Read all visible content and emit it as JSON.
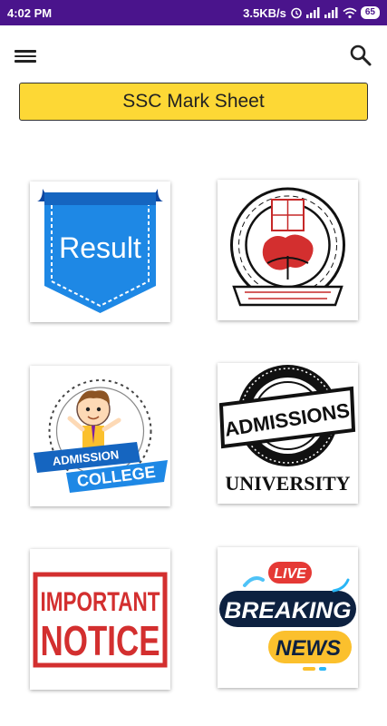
{
  "status_bar": {
    "time": "4:02 PM",
    "network_speed": "3.5KB/s",
    "battery": "65",
    "icons": [
      "alarm-icon",
      "signal-icon",
      "signal-icon",
      "wifi-icon",
      "battery-icon"
    ]
  },
  "toolbar": {
    "menu_icon": "hamburger-menu-icon",
    "search_icon": "search-icon"
  },
  "header": {
    "title": "SSC Mark Sheet",
    "accent": "#fdd835"
  },
  "tiles": {
    "result": {
      "label": "Result",
      "color": "#1e88e5"
    },
    "board_logo": {
      "name": "education-board-logo"
    },
    "admission_college": {
      "line1": "ADMISSION",
      "line2": "COLLEGE",
      "color": "#1565c0"
    },
    "admissions_university": {
      "line1": "ADMISSIONS",
      "line2": "UNIVERSITY"
    },
    "important_notice": {
      "line1": "IMPORTANT",
      "line2": "NOTICE",
      "color": "#d32f2f"
    },
    "breaking_news": {
      "badge": "LIVE",
      "line1": "BREAKING",
      "line2": "NEWS",
      "badge_color": "#e53935",
      "news_color": "#fbc02d"
    }
  }
}
